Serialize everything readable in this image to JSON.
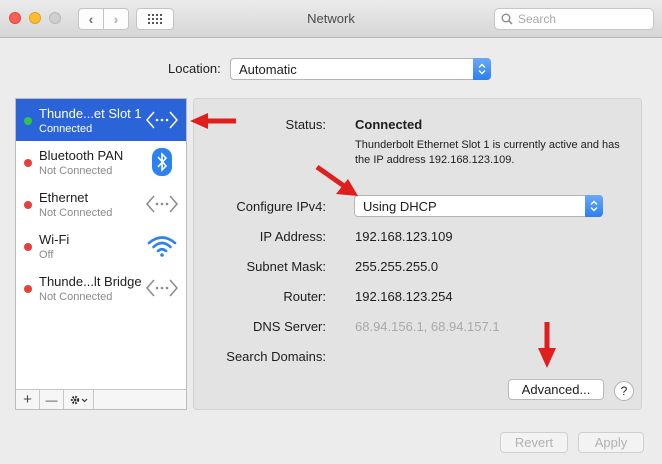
{
  "window": {
    "title": "Network"
  },
  "search": {
    "placeholder": "Search"
  },
  "location": {
    "label": "Location:",
    "value": "Automatic"
  },
  "services": [
    {
      "name": "Thunde...et Slot 1",
      "status": "Connected",
      "dot_color": "#35c24a",
      "icon": "ethernet-icon",
      "selected": true
    },
    {
      "name": "Bluetooth PAN",
      "status": "Not Connected",
      "dot_color": "#e3423a",
      "icon": "bluetooth-icon",
      "selected": false
    },
    {
      "name": "Ethernet",
      "status": "Not Connected",
      "dot_color": "#e3423a",
      "icon": "ethernet-icon",
      "selected": false
    },
    {
      "name": "Wi-Fi",
      "status": "Off",
      "dot_color": "#e3423a",
      "icon": "wifi-icon",
      "selected": false
    },
    {
      "name": "Thunde...lt Bridge",
      "status": "Not Connected",
      "dot_color": "#e3423a",
      "icon": "ethernet-icon",
      "selected": false
    }
  ],
  "sidebar_controls": {
    "add": "+",
    "remove": "—"
  },
  "detail": {
    "status_label": "Status:",
    "status_value": "Connected",
    "status_desc": "Thunderbolt Ethernet Slot 1 is currently active and has the IP address 192.168.123.109.",
    "configure_label": "Configure IPv4:",
    "configure_value": "Using DHCP",
    "ip_label": "IP Address:",
    "ip_value": "192.168.123.109",
    "subnet_label": "Subnet Mask:",
    "subnet_value": "255.255.255.0",
    "router_label": "Router:",
    "router_value": "192.168.123.254",
    "dns_label": "DNS Server:",
    "dns_value": "68.94.156.1, 68.94.157.1",
    "search_domains_label": "Search Domains:",
    "advanced_button": "Advanced...",
    "help_button": "?"
  },
  "footer": {
    "revert": "Revert",
    "apply": "Apply"
  },
  "colors": {
    "accent": "#2a64d8",
    "annotation_arrow": "#e01e1e",
    "connected": "#35c24a",
    "disconnected": "#e3423a"
  }
}
